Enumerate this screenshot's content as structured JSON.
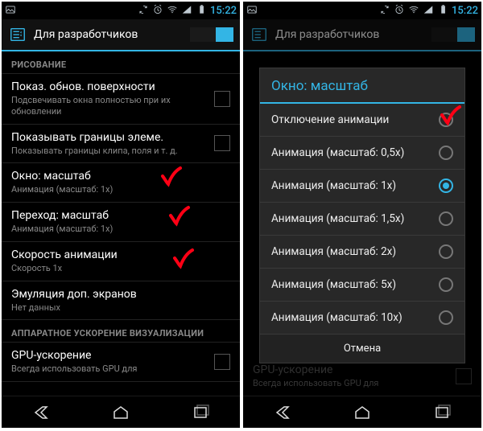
{
  "status": {
    "time": "15:22"
  },
  "screen_title": "Для разработчиков",
  "sections": {
    "drawing": "РИСОВАНИЕ",
    "hw": "АППАРАТНОЕ УСКОРЕНИЕ ВИЗУАЛИЗАЦИИ"
  },
  "prefs": {
    "surface_updates": {
      "title": "Показ. обнов. поверхности",
      "summary": "Подсвечивать окна полностью при их обновлении"
    },
    "layout_bounds": {
      "title": "Показывать границы элеме.",
      "summary": "Показывать границы клипа, поля и т. д."
    },
    "window_scale": {
      "title": "Окно: масштаб",
      "summary": "Анимация (масштаб: 1x)"
    },
    "transition_scale": {
      "title": "Переход: масштаб",
      "summary": "Анимация (масштаб: 1x)"
    },
    "animator_speed": {
      "title": "Скорость анимации",
      "summary": "Скорость 1x"
    },
    "secondary_displays": {
      "title": "Эмуляция доп. экранов",
      "summary": "Нет данных"
    },
    "gpu": {
      "title": "GPU-ускорение",
      "summary": "Всегда использовать GPU для"
    }
  },
  "dialog": {
    "title": "Окно: масштаб",
    "options": [
      "Отключение анимации",
      "Анимация (масштаб: 0,5x)",
      "Анимация (масштаб: 1x)",
      "Анимация (масштаб: 1,5x)",
      "Анимация (масштаб: 2x)",
      "Анимация (масштаб: 5x)",
      "Анимация (масштаб: 10x)"
    ],
    "selected_index": 2,
    "cancel": "Отмена"
  }
}
